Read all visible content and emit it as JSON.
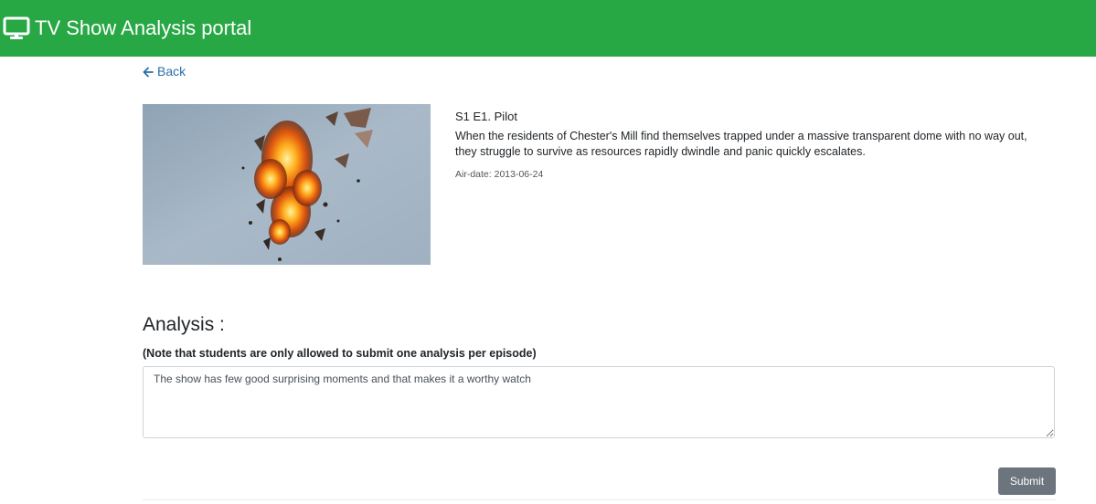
{
  "app": {
    "title": "TV Show Analysis portal",
    "brand_color": "#28a745"
  },
  "nav": {
    "back_label": "Back",
    "back_icon": "arrow-left-icon",
    "link_color": "#2a6fa8"
  },
  "episode": {
    "title": "S1 E1. Pilot",
    "description": "When the residents of Chester's Mill find themselves trapped under a massive transparent dome with no way out, they struggle to survive as resources rapidly dwindle and panic quickly escalates.",
    "airdate": "Air-date: 2013-06-24",
    "thumbnail_icon": "explosion-image"
  },
  "analysis": {
    "heading": "Analysis :",
    "note": "(Note that students are only allowed to submit one analysis per episode)",
    "value": "The show has few good surprising moments and that makes it a worthy watch",
    "submit_label": "Submit",
    "submit_color": "#6c757d"
  }
}
